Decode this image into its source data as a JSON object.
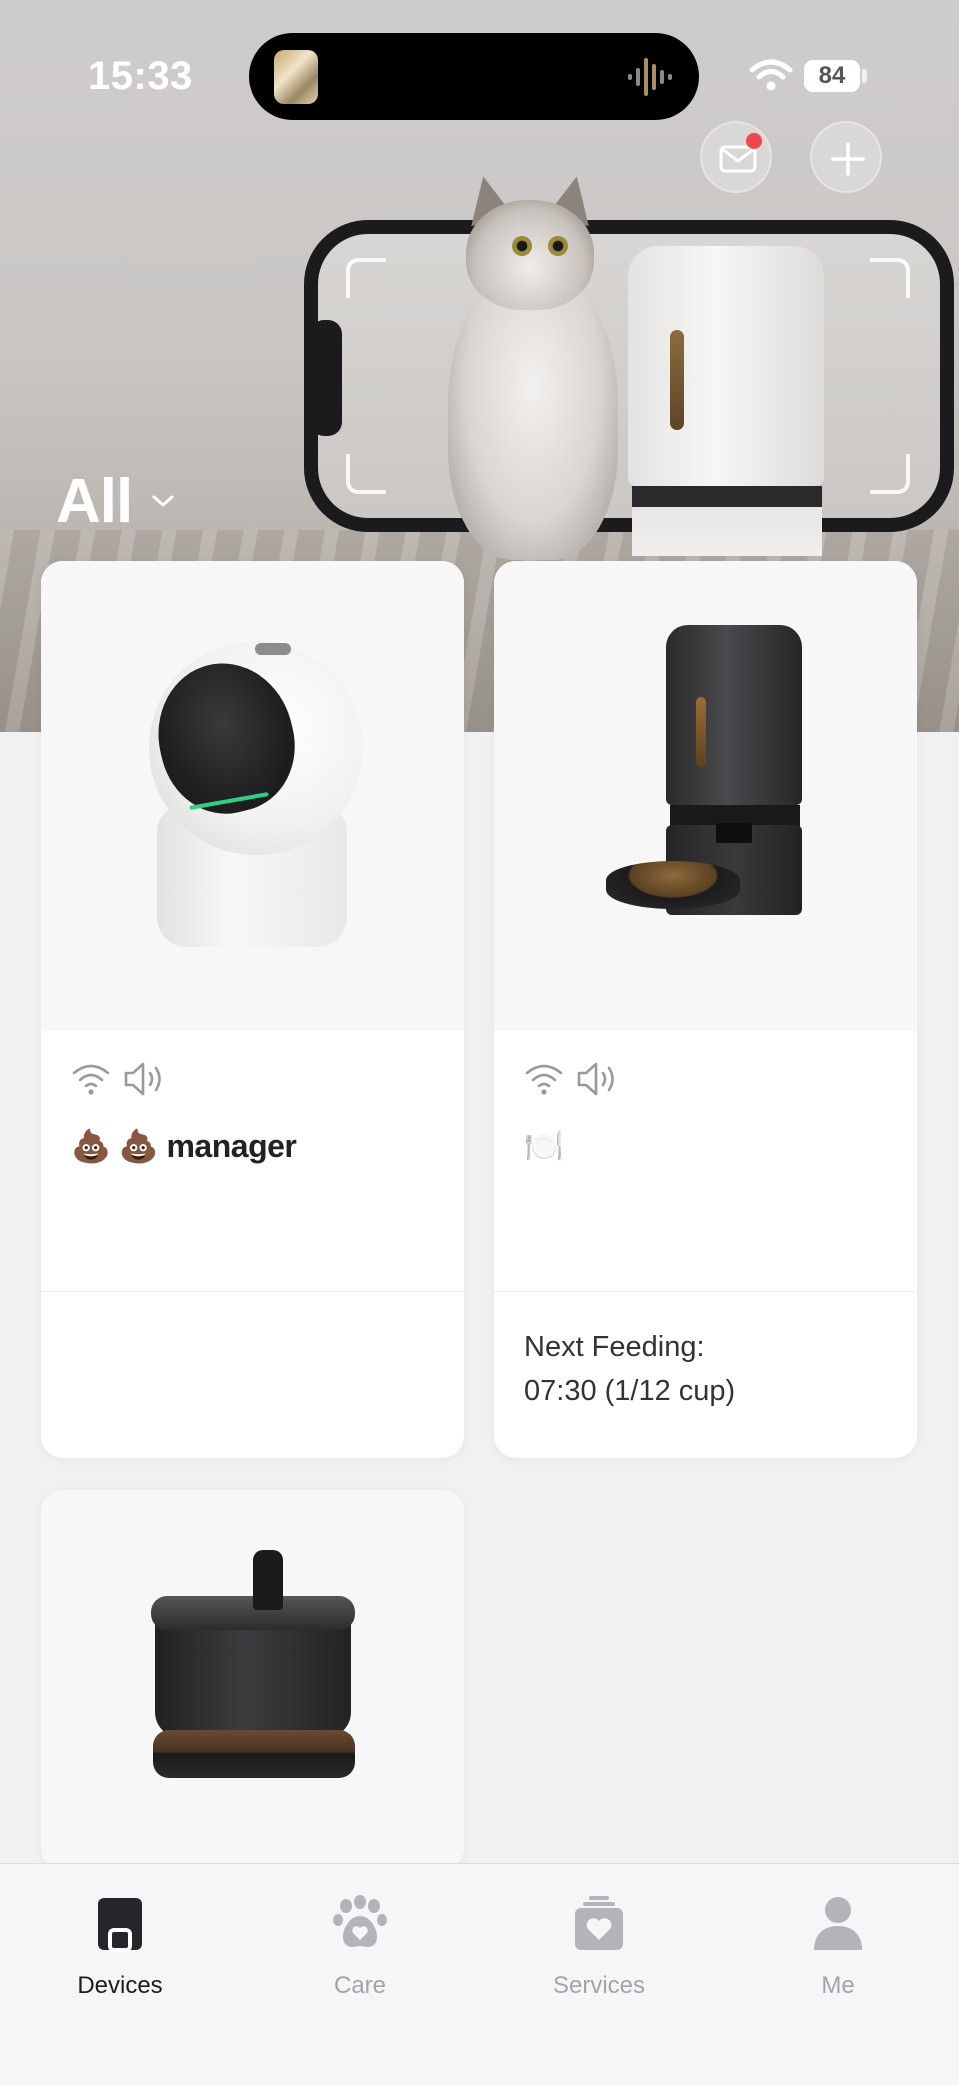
{
  "status_bar": {
    "time": "15:33",
    "battery": "84"
  },
  "header": {
    "filter_label": "All",
    "mail_icon": "mail-icon",
    "add_icon": "plus-icon"
  },
  "devices": [
    {
      "name": "💩 💩 manager",
      "image": "litter-box",
      "status_icons": [
        "wifi-icon",
        "speaker-icon"
      ],
      "schedule": ""
    },
    {
      "name": "🍽️",
      "image": "feeder",
      "status_icons": [
        "wifi-icon",
        "speaker-icon"
      ],
      "next_feeding_label": "Next Feeding:",
      "next_feeding_value": "07:30 (1/12 cup)"
    },
    {
      "name": "",
      "image": "water-fountain",
      "status_icons": []
    }
  ],
  "tabs": [
    {
      "label": "Devices",
      "icon": "devices-icon",
      "active": true
    },
    {
      "label": "Care",
      "icon": "paw-icon",
      "active": false
    },
    {
      "label": "Services",
      "icon": "services-heart-icon",
      "active": false
    },
    {
      "label": "Me",
      "icon": "person-icon",
      "active": false
    }
  ],
  "colors": {
    "accent_dark": "#1c1c1e",
    "inactive_tab": "#a4a4a8",
    "notification_dot": "#f0474b",
    "card_bg": "#ffffff",
    "page_bg": "#f1f1f3"
  }
}
